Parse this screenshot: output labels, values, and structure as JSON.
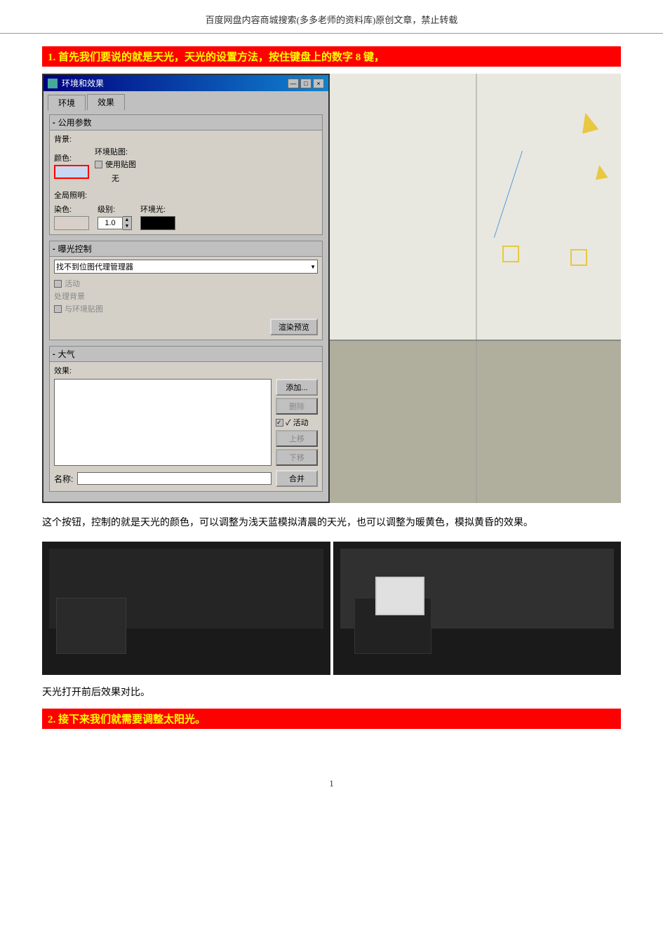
{
  "header": {
    "text": "百度网盘内容商城搜索(多多老师的资料库)原创文章，禁止转载"
  },
  "section1": {
    "title": "1.  首先我们要说的就是天光，天光的设置方法，按住键盘上的数字 8 键，"
  },
  "dialog": {
    "title": "环境和效果",
    "icon": "env-icon",
    "tabs": [
      "环境",
      "效果"
    ],
    "active_tab": "环境",
    "titlebar_buttons": [
      "—",
      "□",
      "×"
    ],
    "public_params_label": "公用参数",
    "background_label": "背景:",
    "color_label": "颜色:",
    "map_label": "环境贴图:",
    "use_map_label": "使用贴图",
    "none_label": "无",
    "global_illumination_label": "全局照明:",
    "gi_color_label": "染色:",
    "gi_level_label": "级别:",
    "gi_level_value": "1.0",
    "gi_ambient_label": "环境光:",
    "exposure_label": "曝光控制",
    "exposure_dropdown": "找不到位图代理管理器",
    "active_label": "活动",
    "process_bg_label": "处理背景",
    "process_map_label": "与环境贴图",
    "render_preview_label": "渲染预览",
    "atmosphere_label": "大气",
    "effects_label": "效果:",
    "add_btn": "添加...",
    "delete_btn": "删除",
    "active_checkbox": "✓ 活动",
    "up_btn": "上移",
    "down_btn": "下移",
    "name_label": "名称:",
    "merge_btn": "合并",
    "minus_symbol": "-"
  },
  "description": {
    "text": "这个按钮，控制的就是天光的颜色，可以调整为浅天蓝模拟清晨的天光，也可以调整为暖黄色，模拟黄昏的效果。"
  },
  "comparison": {
    "caption": "天光打开前后效果对比。"
  },
  "section2": {
    "title": "2.  接下来我们就需要调整太阳光。"
  },
  "page_number": "1"
}
